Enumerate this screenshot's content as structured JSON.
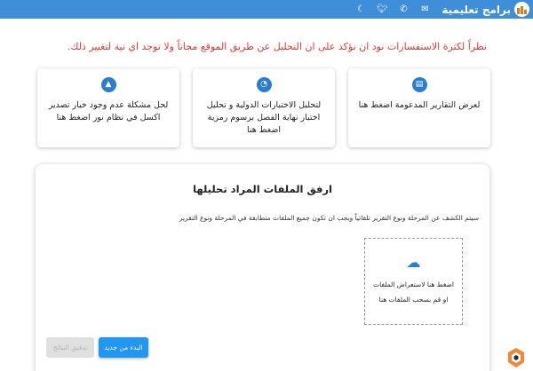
{
  "header": {
    "brand_title": "برامج تعليمية",
    "icons": [
      "bar-chart-logo",
      "email-icon",
      "whatsapp-icon",
      "twitter-icon",
      "moon-icon"
    ]
  },
  "notice": "نظراً لكثرة الاستفسارات نود ان نؤكد على ان التحليل عن طريق الموقع مجاناً ولا توجد اي نية لتغيير ذلك.",
  "cards": [
    {
      "icon": "document-icon",
      "text": "لعرض التقارير المدعومة اضغط هنا"
    },
    {
      "icon": "chart-pie-icon",
      "text": "لتحليل الاختبارات الدولية و تحليل اختبار نهاية الفصل برسوم رمزية اضغط هنا"
    },
    {
      "icon": "warning-icon",
      "text": "لحل مشكلة عدم وجود خيار تصدير اكسل في نظام نور اضغط هنا"
    }
  ],
  "upload": {
    "title": "ارفق الملفات المراد تحليلها",
    "description": "سيتم الكشف عن المرحلة ونوع التقرير تلقائياً ويجب ان تكون جميع الملفات متطابقة في المرحلة ونوع التقرير",
    "dropzone_line1": "اضغط هنا لاستعراض الملفات",
    "dropzone_line2": "او قم بسحب الملفات هنا",
    "restart_label": "البدء من جديد",
    "check_label": "تدقيق النتائج"
  },
  "colors": {
    "header": "#3f8fd8",
    "notice": "#e53935",
    "accent": "#2a7ed1",
    "button": "#2196f3"
  }
}
